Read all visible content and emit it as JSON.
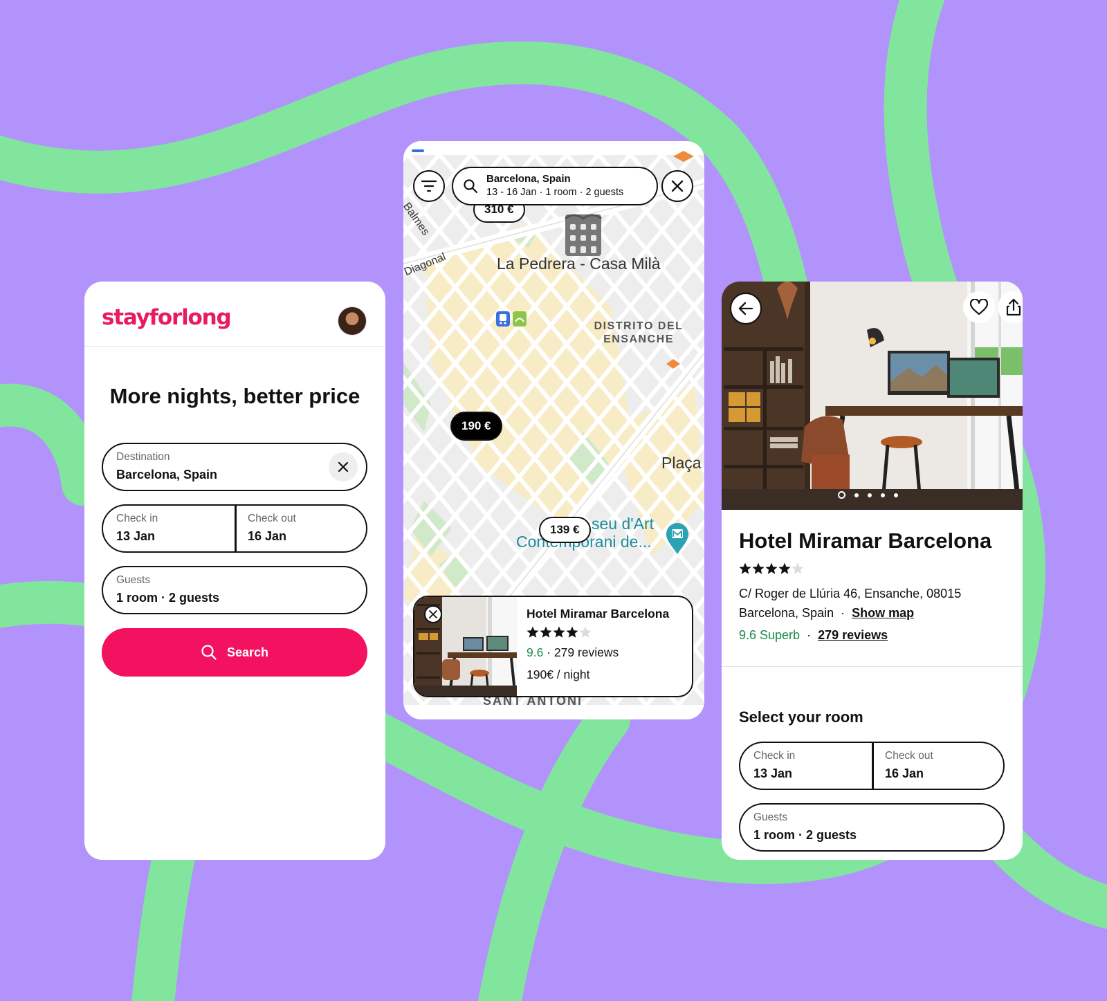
{
  "colors": {
    "background": "#b292fb",
    "curve": "#82e59e",
    "brand": "#e81a62",
    "search_button": "#f2125f",
    "rating_green": "#1b8a47"
  },
  "search_screen": {
    "logo": "stayforlong",
    "headline": "More nights, better price",
    "destination": {
      "label": "Destination",
      "value": "Barcelona, Spain"
    },
    "check_in": {
      "label": "Check in",
      "value": "13 Jan"
    },
    "check_out": {
      "label": "Check out",
      "value": "16 Jan"
    },
    "guests": {
      "label": "Guests",
      "value": "1 room · 2 guests"
    },
    "search_label": "Search",
    "icons": [
      "avatar",
      "close-icon",
      "search-icon"
    ]
  },
  "map_screen": {
    "search_line1": "Barcelona, Spain",
    "search_line2": "13 - 16 Jan · 1 room · 2 guests",
    "price_pins": [
      "310 €",
      "190 €",
      "139 €"
    ],
    "labels": {
      "balmes": "Balmes",
      "diagonal": "Diagonal",
      "pedrera": "La Pedrera - Casa Milà",
      "distrito_line1": "DISTRITO DEL",
      "distrito_line2": "ENSANCHE",
      "placa": "Plaça",
      "museu_line1": "seu d'Art",
      "museu_line2": "Contemporani de...",
      "sant_antoni": "SANT ANTONI"
    },
    "card": {
      "name": "Hotel Miramar Barcelona",
      "stars": 4,
      "score": "9.6",
      "reviews": "279 reviews",
      "price": "190€ / night"
    },
    "icons": [
      "filter-icon",
      "search-icon",
      "close-icon",
      "metro-icon",
      "bike-icon",
      "museum-icon"
    ]
  },
  "hotel_screen": {
    "title": "Hotel Miramar Barcelona",
    "stars": 4,
    "address_line1": "C/ Roger de Llúria 46, Ensanche, 08015",
    "address_line2": "Barcelona, Spain",
    "show_map": "Show map",
    "score": "9.6 Superb",
    "reviews": "279 reviews",
    "photo_count": 5,
    "photo_index": 1,
    "section_title": "Select your room",
    "check_in": {
      "label": "Check in",
      "value": "13 Jan"
    },
    "check_out": {
      "label": "Check out",
      "value": "16 Jan"
    },
    "guests": {
      "label": "Guests",
      "value": "1 room · 2 guests"
    },
    "icons": [
      "back-arrow-icon",
      "heart-icon",
      "share-icon"
    ]
  }
}
